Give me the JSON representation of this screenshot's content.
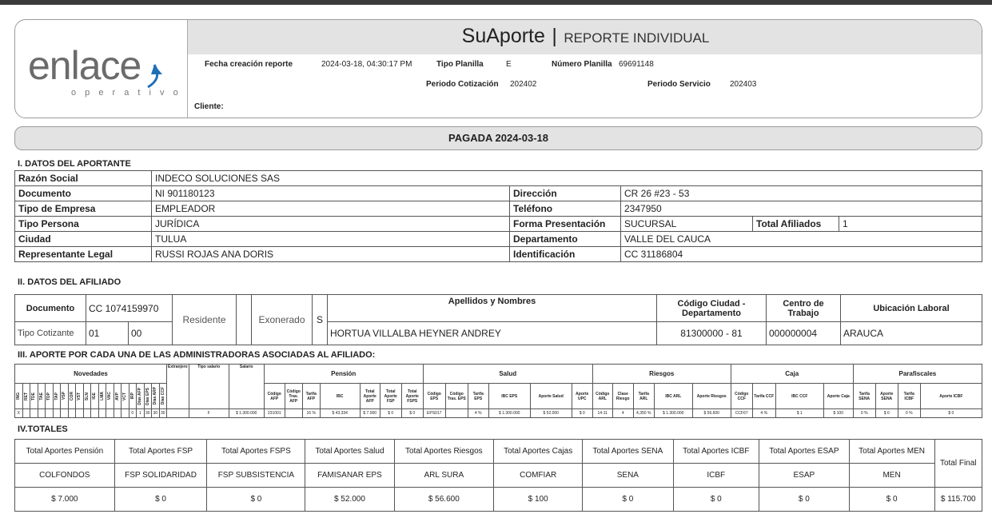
{
  "brand": {
    "name": "enlace",
    "tagline": "o p e r a t i v o"
  },
  "header": {
    "app": "SuAporte",
    "sep": "|",
    "report": "REPORTE INDIVIDUAL",
    "fecha_label": "Fecha creación reporte",
    "fecha_value": "2024-03-18, 04:30:17 PM",
    "tipo_label": "Tipo Planilla",
    "tipo_value": "E",
    "numero_label": "Número Planilla",
    "numero_value": "69691148",
    "periodo_cot_label": "Periodo Cotización",
    "periodo_cot_value": "202402",
    "periodo_serv_label": "Periodo Servicio",
    "periodo_serv_value": "202403",
    "cliente_label": "Cliente:"
  },
  "status": "PAGADA 2024-03-18",
  "aportante": {
    "title": "I. DATOS DEL APORTANTE",
    "razon_label": "Razón Social",
    "razon_value": "INDECO SOLUCIONES SAS",
    "doc_label": "Documento",
    "doc_value": "NI 901180123",
    "dir_label": "Dirección",
    "dir_value": "CR 26 #23 - 53",
    "tipoemp_label": "Tipo de Empresa",
    "tipoemp_value": "EMPLEADOR",
    "tel_label": "Teléfono",
    "tel_value": "2347950",
    "tipoper_label": "Tipo Persona",
    "tipoper_value": "JURÍDICA",
    "forma_label": "Forma Presentación",
    "forma_value": "SUCURSAL",
    "afil_label": "Total Afiliados",
    "afil_value": "1",
    "ciudad_label": "Ciudad",
    "ciudad_value": "TULUA",
    "depto_label": "Departamento",
    "depto_value": "VALLE DEL CAUCA",
    "rep_label": "Representante Legal",
    "rep_value": "RUSSI ROJAS ANA DORIS",
    "id_label": "Identificación",
    "id_value": "CC 31186804"
  },
  "afiliado": {
    "title": "II. DATOS DEL AFILIADO",
    "doc_label": "Documento",
    "doc_value": "CC 1074159970",
    "residente_label": "Residente",
    "residente_value": "",
    "exonerado_label": "Exonerado",
    "exonerado_value": "S",
    "nombres_label": "Apellidos y Nombres",
    "nombres_value": "HORTUA VILLALBA HEYNER ANDREY",
    "ciudad_label": "Código Ciudad - Departamento",
    "ciudad_value": "81300000 - 81",
    "centro_label": "Centro de Trabajo",
    "centro_value": "000000004",
    "ubic_label": "Ubicación Laboral",
    "ubic_value": "ARAUCA",
    "tipo_cot_label": "Tipo Cotizante",
    "tipo_cot_value": "01",
    "subtipo_value": "00"
  },
  "aportes": {
    "title": "III. APORTE POR CADA UNA DE LAS ADMINISTRADORAS ASOCIADAS AL AFILIADO:",
    "groups": {
      "novedades": "Novedades",
      "extranjero": "Extranjero",
      "tipo_salario": "Tipo salario",
      "salario": "Salario",
      "pension": "Pensión",
      "salud": "Salud",
      "riesgos": "Riesgos",
      "caja": "Caja",
      "parafiscales": "Parafiscales"
    },
    "novedades_cols": [
      "ING",
      "RET",
      "TDE",
      "TAE",
      "TDP",
      "TAP",
      "VSP",
      "COR",
      "VST",
      "SLN",
      "IGE",
      "LMA",
      "VAC",
      "AVP",
      "VCT",
      "IRP",
      "Días AFP",
      "Días EPS",
      "Días ARP",
      "Días CCF"
    ],
    "novedades_vals": [
      "X",
      "",
      "",
      "",
      "",
      "",
      "",
      "",
      "",
      "",
      "",
      "",
      "",
      "",
      "",
      "0",
      "1",
      "30",
      "30",
      "30"
    ],
    "sub_headers": [
      "Código AFP",
      "Código Tras. AFP",
      "Tarifa AFP",
      "IBC",
      "Total Aporte AFP",
      "Total Aporte FSP",
      "Total Aporte FSPS",
      "Código EPS",
      "Código Tras. EPS",
      "Tarifa EPS",
      "IBC EPS",
      "Aporte Salud",
      "Aporte UPC",
      "Código ARL",
      "Clase Riesgo",
      "Tarifa ARL",
      "IBC ARL",
      "Aporte Riesgos",
      "Código CCF",
      "Tarifa CCF",
      "IBC CCF",
      "Aporte Caja",
      "Tarifa SENA",
      "Aporte SENA",
      "Tarifa ICBF",
      "Aporte ICBF"
    ],
    "row": {
      "extranjero": "",
      "tipo_salario": "F",
      "salario": "$ 1.300.000",
      "values": [
        "231001",
        "",
        "16 %",
        "$ 43.334",
        "$ 7.000",
        "$ 0",
        "$ 0",
        "EPS017",
        "",
        "4 %",
        "$ 1.300.000",
        "$ 52.000",
        "$ 0",
        "14-11",
        "4",
        "4,350 %",
        "$ 1.300.000",
        "$ 56.600",
        "CCF67",
        "4 %",
        "$ 1",
        "$ 100",
        "0 %",
        "$ 0",
        "0 %",
        "$ 0"
      ]
    }
  },
  "totales": {
    "title": "IV.TOTALES",
    "headers": [
      "Total Aportes Pensión",
      "Total Aportes FSP",
      "Total Aportes FSPS",
      "Total Aportes Salud",
      "Total Aportes Riesgos",
      "Total Aportes Cajas",
      "Total Aportes SENA",
      "Total Aportes ICBF",
      "Total Aportes ESAP",
      "Total Aportes MEN",
      "Total Final"
    ],
    "entities": [
      "COLFONDOS",
      "FSP SOLIDARIDAD",
      "FSP SUBSISTENCIA",
      "FAMISANAR EPS",
      "ARL SURA",
      "COMFIAR",
      "SENA",
      "ICBF",
      "ESAP",
      "MEN"
    ],
    "values": [
      "$ 7.000",
      "$ 0",
      "$ 0",
      "$ 52.000",
      "$ 56.600",
      "$ 100",
      "$ 0",
      "$ 0",
      "$ 0",
      "$ 0",
      "$ 115.700"
    ]
  },
  "colors": {
    "band": "#e3e3e3",
    "border": "#555555",
    "logo_blue": "#1f6fb5"
  },
  "icons": [
    "enlace-logo-icon"
  ]
}
